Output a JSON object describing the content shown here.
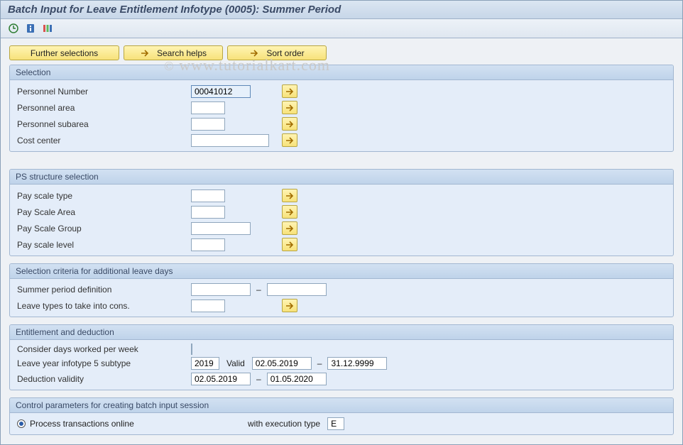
{
  "title": "Batch Input for Leave Entitlement Infotype (0005): Summer Period",
  "watermark": "www.tutorialkart.com",
  "top_buttons": {
    "further_selections": "Further selections",
    "search_helps": "Search helps",
    "sort_order": "Sort order"
  },
  "groups": {
    "selection": {
      "title": "Selection",
      "personnel_number_label": "Personnel Number",
      "personnel_number_value": "00041012",
      "personnel_area_label": "Personnel area",
      "personnel_area_value": "",
      "personnel_subarea_label": "Personnel subarea",
      "personnel_subarea_value": "",
      "cost_center_label": "Cost center",
      "cost_center_value": ""
    },
    "ps_structure": {
      "title": "PS structure selection",
      "pay_scale_type_label": "Pay scale type",
      "pay_scale_type_value": "",
      "pay_scale_area_label": "Pay Scale Area",
      "pay_scale_area_value": "",
      "pay_scale_group_label": "Pay Scale Group",
      "pay_scale_group_value": "",
      "pay_scale_level_label": "Pay scale level",
      "pay_scale_level_value": ""
    },
    "additional_leave": {
      "title": "Selection criteria for additional leave days",
      "summer_period_label": "Summer period definition",
      "summer_period_from": "",
      "summer_period_to": "",
      "leave_types_label": "Leave types to take into cons.",
      "leave_types_value": ""
    },
    "entitlement": {
      "title": "Entitlement and deduction",
      "consider_days_label": "Consider days worked per week",
      "leave_year_label": "Leave year infotype 5 subtype",
      "leave_year_value": "2019",
      "valid_label": "Valid",
      "valid_from": "02.05.2019",
      "valid_to": "31.12.9999",
      "deduction_label": "Deduction validity",
      "deduction_from": "02.05.2019",
      "deduction_to": "01.05.2020"
    },
    "control_params": {
      "title": "Control parameters for creating batch input session",
      "process_online_label": "Process transactions online",
      "exec_type_label": "with execution type",
      "exec_type_value": "E"
    }
  }
}
